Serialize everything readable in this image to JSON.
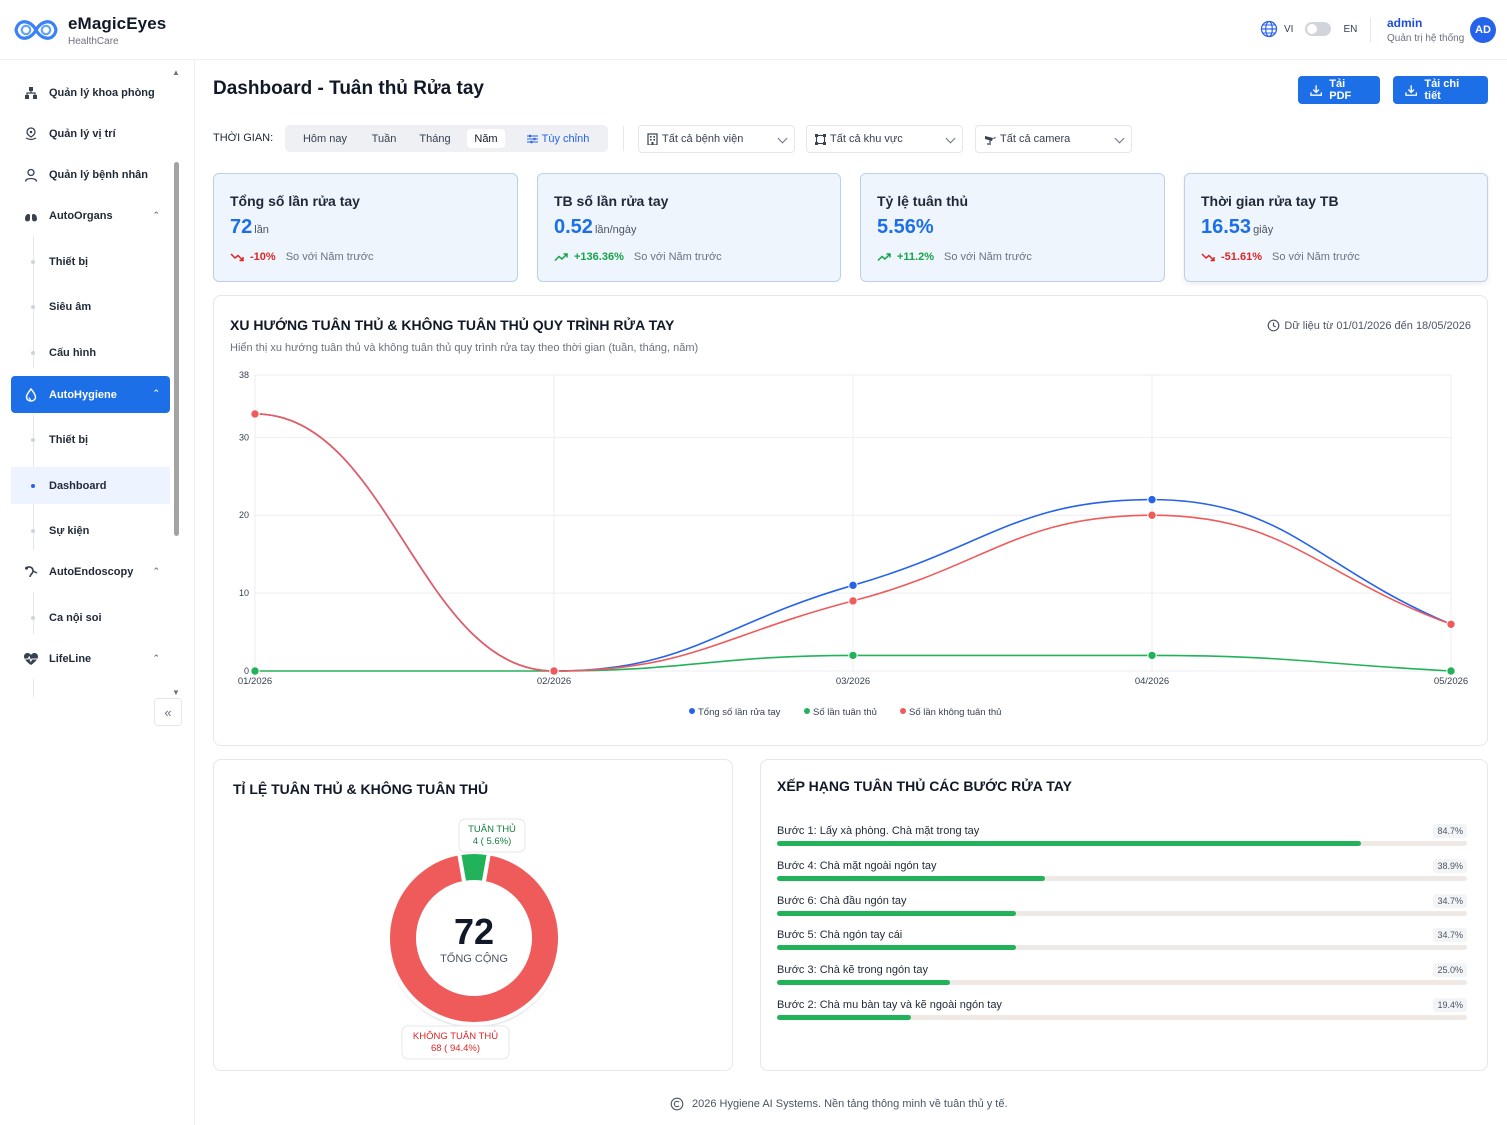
{
  "header": {
    "brand_name": "eMagicEyes",
    "brand_sub": "HealthCare",
    "lang_vi": "VI",
    "lang_en": "EN",
    "user_name": "admin",
    "user_role": "Quản trị hệ thống",
    "avatar": "AD"
  },
  "sidebar": {
    "items": [
      {
        "label": "Quản lý khoa phòng",
        "icon": "org-icon"
      },
      {
        "label": "Quản lý vị trí",
        "icon": "location-icon"
      },
      {
        "label": "Quản lý bệnh nhân",
        "icon": "user-icon"
      },
      {
        "label": "AutoOrgans",
        "icon": "lungs-icon"
      },
      {
        "label": "Thiết bị"
      },
      {
        "label": "Siêu âm"
      },
      {
        "label": "Cấu hình"
      },
      {
        "label": "AutoHygiene",
        "icon": "drop-icon"
      },
      {
        "label": "Thiết bị"
      },
      {
        "label": "Dashboard"
      },
      {
        "label": "Sự kiện"
      },
      {
        "label": "AutoEndoscopy",
        "icon": "endoscope-icon"
      },
      {
        "label": "Ca nội soi"
      },
      {
        "label": "LifeLine",
        "icon": "heart-icon"
      }
    ],
    "collapse": "«"
  },
  "main": {
    "title": "Dashboard - Tuân thủ Rửa tay",
    "btn_pdf": "Tải PDF",
    "btn_detail": "Tải chi tiết",
    "time_label": "THỜI GIAN:",
    "time_options": [
      "Hôm nay",
      "Tuần",
      "Tháng",
      "Năm",
      "Tùy chỉnh"
    ],
    "selected_time": "Năm",
    "filters": [
      "Tất cả bệnh viện",
      "Tất cả khu vực",
      "Tất cả camera"
    ]
  },
  "stats": [
    {
      "label": "Tổng số lần rửa tay",
      "value": "72",
      "unit": "lần",
      "change": "-10%",
      "direction": "down",
      "compare": "So với Năm trước"
    },
    {
      "label": "TB số lần rửa tay",
      "value": "0.52",
      "unit": "lần/ngày",
      "change": "+136.36%",
      "direction": "up",
      "compare": "So với Năm trước"
    },
    {
      "label": "Tỷ lệ tuân thủ",
      "value": "5.56%",
      "unit": "",
      "change": "+11.2%",
      "direction": "up",
      "compare": "So với Năm trước"
    },
    {
      "label": "Thời gian rửa tay TB",
      "value": "16.53",
      "unit": "giây",
      "change": "-51.61%",
      "direction": "down",
      "compare": "So với Năm trước"
    }
  ],
  "colors": {
    "accent": "#1d6fe8",
    "series_total": "#2563eb",
    "series_compliant": "#22b35a",
    "series_noncompliant": "#ef5a5a"
  },
  "chart_data": [
    {
      "type": "line",
      "title": "XU HƯỚNG TUÂN THỦ & KHÔNG TUÂN THỦ QUY TRÌNH RỬA TAY",
      "subtitle": "Hiển thị xu hướng tuân thủ và không tuân thủ quy trình rửa tay theo thời gian (tuần, tháng, năm)",
      "date_range": "Dữ liệu từ 01/01/2026 đến 18/05/2026",
      "categories": [
        "01/2026",
        "02/2026",
        "03/2026",
        "04/2026",
        "05/2026"
      ],
      "ylim": [
        0,
        38
      ],
      "yticks": [
        0,
        10,
        20,
        30,
        38
      ],
      "grid": true,
      "legend": "bottom",
      "series": [
        {
          "name": "Tổng số lần rửa tay",
          "values": [
            33,
            0,
            11,
            22,
            6
          ]
        },
        {
          "name": "Số lần tuân thủ",
          "values": [
            0,
            0,
            2,
            2,
            0
          ]
        },
        {
          "name": "Số lần không tuân thủ",
          "values": [
            33,
            0,
            9,
            20,
            6
          ]
        }
      ]
    },
    {
      "type": "pie",
      "title": "TỈ LỆ TUÂN THỦ & KHÔNG TUÂN THỦ",
      "total": "72",
      "total_label": "TỔNG CỘNG",
      "slices": [
        {
          "name": "TUÂN THỦ",
          "value": 4,
          "label": "4 ( 5.6%)"
        },
        {
          "name": "KHÔNG TUÂN THỦ",
          "value": 68,
          "label": "68 ( 94.4%)"
        }
      ]
    },
    {
      "type": "bar",
      "title": "XẾP HẠNG TUÂN THỦ CÁC BƯỚC RỬA TAY",
      "categories": [
        "Bước 1: Lấy xà phòng. Chà mặt trong tay",
        "Bước 4: Chà mặt ngoài ngón tay",
        "Bước 6: Chà đầu ngón tay",
        "Bước 5: Chà ngón tay cái",
        "Bước 3: Chà kẽ trong ngón tay",
        "Bước 2: Chà mu bàn tay và kẽ ngoài ngón tay"
      ],
      "values": [
        84.7,
        38.9,
        34.7,
        34.7,
        25.0,
        19.4
      ],
      "labels": [
        "84.7%",
        "38.9%",
        "34.7%",
        "34.7%",
        "25.0%",
        "19.4%"
      ],
      "ylim": [
        0,
        100
      ]
    }
  ],
  "footer": "2026 Hygiene AI Systems. Nền tảng thông minh về tuân thủ y tế."
}
